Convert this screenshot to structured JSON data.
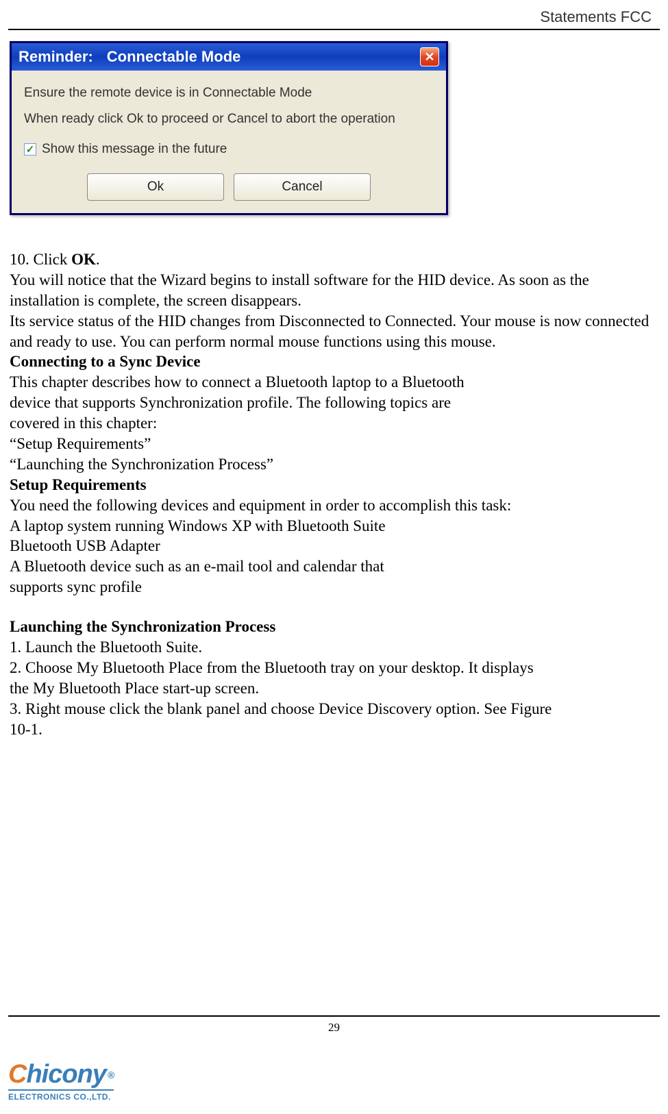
{
  "header": "Statements  FCC",
  "dialog": {
    "title_prefix": "Reminder:",
    "title_main": "Connectable Mode",
    "close_label": "✕",
    "line1": "Ensure the remote device is in    Connectable Mode",
    "line2": "When ready click Ok to proceed or Cancel to abort the operation",
    "checkbox_checked": "✓",
    "checkbox_label": "Show this message in the future",
    "ok_label": "Ok",
    "cancel_label": "Cancel"
  },
  "body": {
    "step10_prefix": "10. Click ",
    "step10_bold": "OK",
    "step10_suffix": ".",
    "p1": "You will notice that the Wizard begins to install software for the HID device. As soon as the installation is complete, the screen disappears.",
    "p2": "Its service status of the HID changes from Disconnected to Connected. Your mouse is now connected and ready to use. You can perform normal mouse functions using this mouse.",
    "h1": "Connecting to a Sync Device",
    "p3a": "This chapter describes how to connect a Bluetooth laptop to a Bluetooth",
    "p3b": "device that supports Synchronization profile. The following topics are",
    "p3c": "covered in this chapter:",
    "p4": "“Setup Requirements”",
    "p5": "“Launching the Synchronization Process”",
    "h2": "Setup Requirements",
    "p6": "You need the following devices and equipment in order to accomplish this task:",
    "p7": "A laptop system running Windows XP with Bluetooth Suite",
    "p8": "Bluetooth USB Adapter",
    "p9a": "A Bluetooth device such as an e-mail tool and calendar that",
    "p9b": "supports sync profile",
    "h3": "Launching the Synchronization Process",
    "p10": "1. Launch the Bluetooth Suite.",
    "p11a": "2. Choose My Bluetooth Place from the Bluetooth tray on your desktop. It displays",
    "p11b": "the My Bluetooth Place start-up screen.",
    "p12a": "3. Right mouse click the blank panel and choose Device Discovery option. See Figure",
    "p12b": "10-1."
  },
  "page_number": "29",
  "logo": {
    "brand": "Chicony",
    "registered": "®",
    "subtitle": "ELECTRONICS CO.,LTD."
  }
}
